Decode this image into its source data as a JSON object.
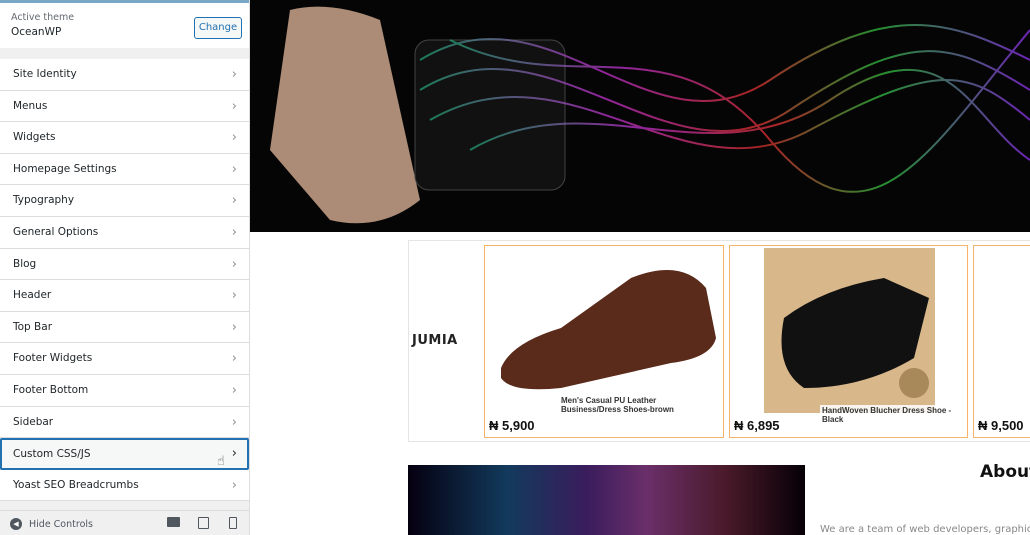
{
  "sidebar": {
    "active_theme_label": "Active theme",
    "theme_name": "OceanWP",
    "change_label": "Change",
    "items": [
      {
        "label": "Site Identity"
      },
      {
        "label": "Menus"
      },
      {
        "label": "Widgets"
      },
      {
        "label": "Homepage Settings"
      },
      {
        "label": "Typography"
      },
      {
        "label": "General Options"
      },
      {
        "label": "Blog"
      },
      {
        "label": "Header"
      },
      {
        "label": "Top Bar"
      },
      {
        "label": "Footer Widgets"
      },
      {
        "label": "Footer Bottom"
      },
      {
        "label": "Sidebar"
      },
      {
        "label": "Custom CSS/JS"
      },
      {
        "label": "Yoast SEO Breadcrumbs"
      }
    ],
    "active_item": "Custom CSS/JS",
    "hide_controls": "Hide Controls"
  },
  "preview": {
    "logo": "JUMIA",
    "products": [
      {
        "name": "Men's Casual PU Leather Business/Dress Shoes-brown",
        "price": "₦ 5,900"
      },
      {
        "name": "HandWoven Blucher Dress Shoe - Black",
        "price": "₦ 6,895"
      },
      {
        "name": "",
        "price": "₦ 9,500"
      }
    ],
    "about_title": "About",
    "about_text": "We are a team of web developers, graphic"
  },
  "colors": {
    "accent": "#2271b1",
    "card_border": "#f5b46a"
  }
}
